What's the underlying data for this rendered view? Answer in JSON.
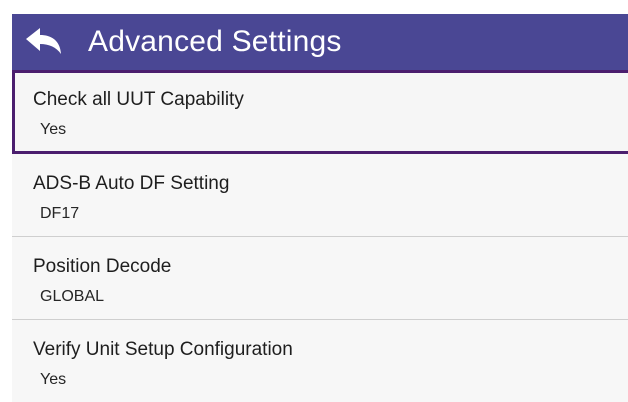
{
  "header": {
    "title": "Advanced Settings",
    "back_icon": "back-arrow-icon"
  },
  "colors": {
    "header_bg": "#4a4794",
    "selected_border": "#4b1e6e",
    "item_bg": "#f7f7f7",
    "divider": "#cfcfcf"
  },
  "settings": [
    {
      "label": "Check all UUT Capability",
      "value": "Yes",
      "selected": true
    },
    {
      "label": "ADS-B Auto DF Setting",
      "value": "DF17",
      "selected": false
    },
    {
      "label": "Position Decode",
      "value": "GLOBAL",
      "selected": false
    },
    {
      "label": "Verify Unit Setup Configuration",
      "value": "Yes",
      "selected": false
    }
  ]
}
